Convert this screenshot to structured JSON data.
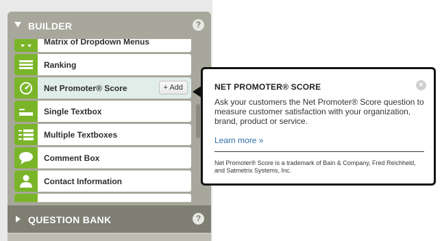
{
  "builder": {
    "title": "BUILDER",
    "help": "?",
    "items": [
      {
        "label": "Matrix of Dropdown Menus",
        "icon": "matrix-dropdown-icon"
      },
      {
        "label": "Ranking",
        "icon": "ranking-icon"
      },
      {
        "label": "Net Promoter® Score",
        "icon": "gauge-icon",
        "active": true,
        "add_label": "+ Add"
      },
      {
        "label": "Single Textbox",
        "icon": "single-textbox-icon"
      },
      {
        "label": "Multiple Textboxes",
        "icon": "multiple-textboxes-icon"
      },
      {
        "label": "Comment Box",
        "icon": "speech-bubble-icon"
      },
      {
        "label": "Contact Information",
        "icon": "person-icon"
      }
    ]
  },
  "question_bank": {
    "title": "QUESTION BANK",
    "help": "?"
  },
  "tooltip": {
    "title": "NET PROMOTER® SCORE",
    "close": "×",
    "description": "Ask your customers the Net Promoter® Score question to measure customer satisfaction with your organization, brand, product or service.",
    "learn_more": "Learn more »",
    "footnote": "Net Promoter® Score is a trademark of Bain & Company, Fred Reichheld, and Satmetrix Systems, Inc."
  },
  "colors": {
    "panel": "#a8a79c",
    "icon_green": "#7ab529",
    "active_row": "#e1ede9",
    "link": "#2f6fa8"
  }
}
